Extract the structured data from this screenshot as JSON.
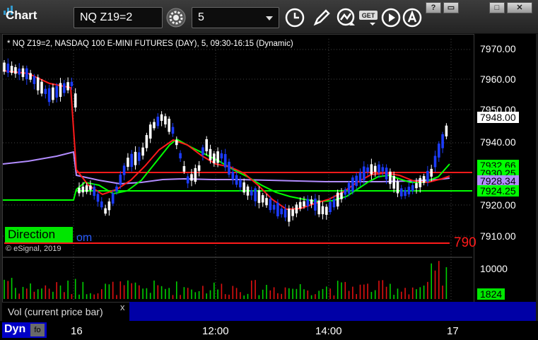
{
  "titlebar": {
    "app_title": "Chart",
    "symbol": "NQ Z19=2",
    "interval": "5",
    "window_buttons": [
      "?",
      "▭",
      "□",
      "✕"
    ]
  },
  "chart": {
    "description": "* NQ Z19=2, NASDAQ 100 E-MINI FUTURES (DAY), 5, 09:30-16:15 (Dynamic)",
    "copyright": "© eSignal, 2019",
    "direction_label": "Direction",
    "direction_tail": "om",
    "red_overlay_price": "790",
    "price_ticks": [
      "7970.00",
      "7960.00",
      "7950.00",
      "7940.00",
      "7930.00",
      "7920.00",
      "7910.00"
    ],
    "tags": {
      "last": "7948.00",
      "a": "7932.66",
      "b": "7930.25",
      "c": "7928.34",
      "d": "7924.25"
    },
    "colors": {
      "up_candle": "#ffffff",
      "down_candle": "#1c3cff",
      "green_ma": "#00ff00",
      "red_ma": "#ff1a1a",
      "purple_ma": "#b28cff"
    }
  },
  "volume": {
    "label": "Vol (current price bar)",
    "close": "x",
    "ticks": [
      "10000"
    ],
    "current": "1824"
  },
  "time_axis": {
    "mode": "Dyn",
    "mode_icon": "fo",
    "labels": [
      "16",
      "12:00",
      "14:00",
      "17"
    ]
  }
}
